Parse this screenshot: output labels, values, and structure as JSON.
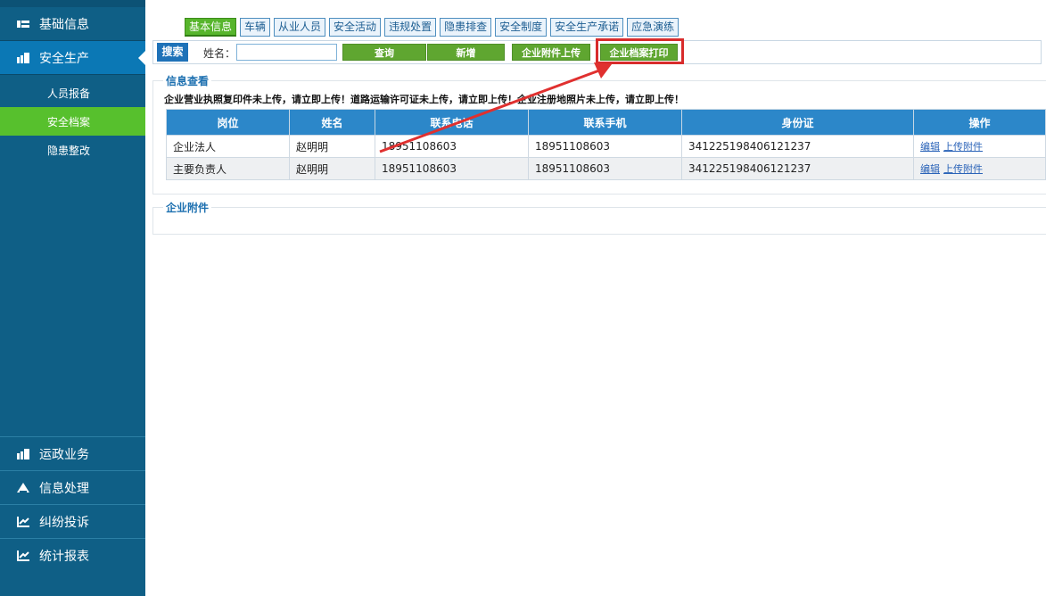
{
  "sidebar": {
    "top_items": [
      {
        "label": "基础信息",
        "icon": "card-icon"
      },
      {
        "label": "安全生产",
        "icon": "grid-icon"
      }
    ],
    "sub_items": [
      {
        "label": "人员报备"
      },
      {
        "label": "安全档案"
      },
      {
        "label": "隐患整改"
      }
    ],
    "bottom_items": [
      {
        "label": "运政业务",
        "icon": "grid-icon"
      },
      {
        "label": "信息处理",
        "icon": "triangle-icon"
      },
      {
        "label": "纠纷投诉",
        "icon": "chart-icon"
      },
      {
        "label": "统计报表",
        "icon": "chart-icon"
      }
    ]
  },
  "tabs": [
    {
      "label": "基本信息"
    },
    {
      "label": "车辆"
    },
    {
      "label": "从业人员"
    },
    {
      "label": "安全活动"
    },
    {
      "label": "违规处置"
    },
    {
      "label": "隐患排查"
    },
    {
      "label": "安全制度"
    },
    {
      "label": "安全生产承诺"
    },
    {
      "label": "应急演练"
    }
  ],
  "toolbar": {
    "search_tag": "搜索",
    "name_label": "姓名：",
    "name_value": "",
    "query_button": "查询",
    "add_button": "新增",
    "upload_button": "企业附件上传",
    "print_button": "企业档案打印"
  },
  "info": {
    "legend": "信息查看",
    "warning": "企业营业执照复印件未上传，请立即上传！道路运输许可证未上传，请立即上传！企业注册地照片未上传，请立即上传！",
    "columns": [
      "岗位",
      "姓名",
      "联系电话",
      "联系手机",
      "身份证",
      "操作"
    ],
    "rows": [
      {
        "post": "企业法人",
        "name": "赵明明",
        "phone": "18951108603",
        "mobile": "18951108603",
        "id_card": "341225198406121237",
        "edit": "编辑",
        "upload": "上传附件"
      },
      {
        "post": "主要负责人",
        "name": "赵明明",
        "phone": "18951108603",
        "mobile": "18951108603",
        "id_card": "341225198406121237",
        "edit": "编辑",
        "upload": "上传附件"
      }
    ]
  },
  "attachments": {
    "legend": "企业附件"
  },
  "colors": {
    "sidebar": "#0f5f86",
    "active_blue": "#0b78b5",
    "active_green": "#57c02d",
    "header_blue": "#2c87c9",
    "highlight_red": "#d82c2c"
  }
}
